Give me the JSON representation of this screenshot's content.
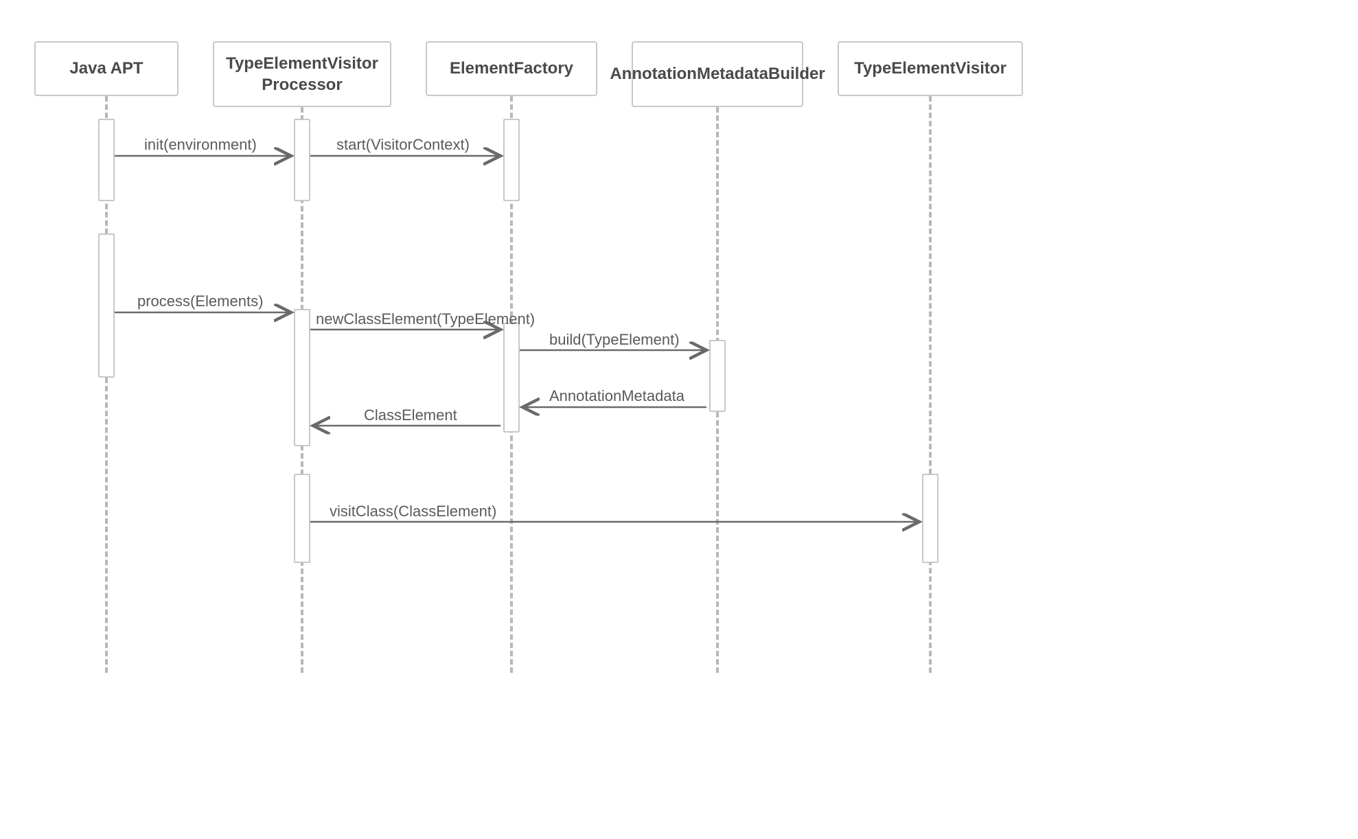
{
  "diagram_type": "sequence",
  "participants": [
    {
      "id": "java-apt",
      "label": "Java APT"
    },
    {
      "id": "tev-processor",
      "label": "TypeElementVisitor\nProcessor"
    },
    {
      "id": "element-factory",
      "label": "ElementFactory"
    },
    {
      "id": "annotation-builder",
      "label": "AnnotationMetadataBuilder"
    },
    {
      "id": "tev",
      "label": "TypeElementVisitor"
    }
  ],
  "messages": [
    {
      "from": "java-apt",
      "to": "tev-processor",
      "label": "init(environment)",
      "direction": "right"
    },
    {
      "from": "tev-processor",
      "to": "element-factory",
      "label": "start(VisitorContext)",
      "direction": "right"
    },
    {
      "from": "java-apt",
      "to": "tev-processor",
      "label": "process(Elements)",
      "direction": "right"
    },
    {
      "from": "tev-processor",
      "to": "element-factory",
      "label": "newClassElement(TypeElement)",
      "direction": "right"
    },
    {
      "from": "element-factory",
      "to": "annotation-builder",
      "label": "build(TypeElement)",
      "direction": "right"
    },
    {
      "from": "annotation-builder",
      "to": "element-factory",
      "label": "AnnotationMetadata",
      "direction": "left"
    },
    {
      "from": "element-factory",
      "to": "tev-processor",
      "label": "ClassElement",
      "direction": "left"
    },
    {
      "from": "tev-processor",
      "to": "tev",
      "label": "visitClass(ClassElement)",
      "direction": "right"
    }
  ]
}
